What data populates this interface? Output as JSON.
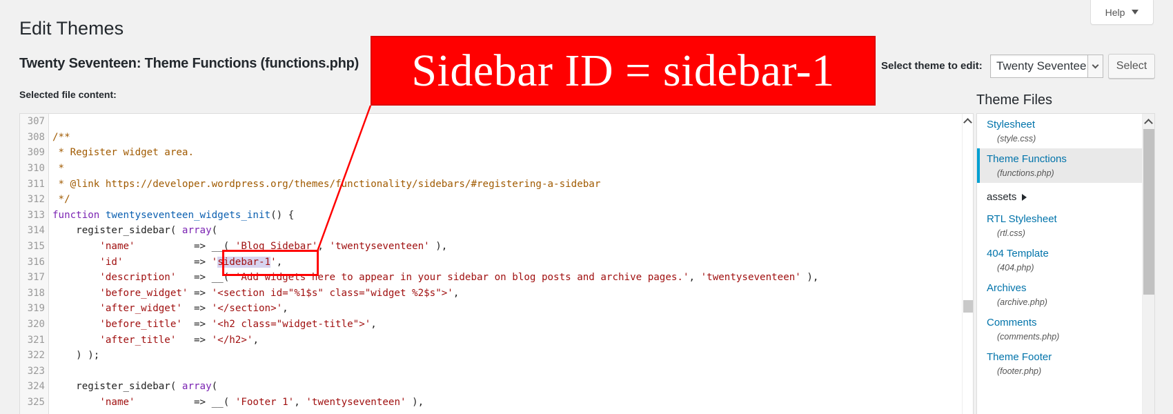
{
  "help": {
    "label": "Help"
  },
  "page_title": "Edit Themes",
  "file_heading": "Twenty Seventeen: Theme Functions (functions.php)",
  "theme_selector": {
    "label": "Select theme to edit:",
    "value": "Twenty Seventee",
    "button": "Select"
  },
  "selected_label": "Selected file content:",
  "theme_files": {
    "title": "Theme Files",
    "items": [
      {
        "name": "Stylesheet",
        "file": "(style.css)"
      },
      {
        "name": "Theme Functions",
        "file": "(functions.php)",
        "active": true
      },
      {
        "folder": "assets"
      },
      {
        "name": "RTL Stylesheet",
        "file": "(rtl.css)"
      },
      {
        "name": "404 Template",
        "file": "(404.php)"
      },
      {
        "name": "Archives",
        "file": "(archive.php)"
      },
      {
        "name": "Comments",
        "file": "(comments.php)"
      },
      {
        "name": "Theme Footer",
        "file": "(footer.php)"
      }
    ]
  },
  "annotation": {
    "text": "Sidebar ID = sidebar-1"
  },
  "code": [
    {
      "n": "307",
      "segs": [
        [
          "",
          "def"
        ]
      ]
    },
    {
      "n": "308",
      "segs": [
        [
          "/**",
          "com"
        ]
      ]
    },
    {
      "n": "309",
      "segs": [
        [
          " * Register widget area.",
          "com"
        ]
      ]
    },
    {
      "n": "310",
      "segs": [
        [
          " *",
          "com"
        ]
      ]
    },
    {
      "n": "311",
      "segs": [
        [
          " * @link https://developer.wordpress.org/themes/functionality/sidebars/#registering-a-sidebar",
          "com"
        ]
      ]
    },
    {
      "n": "312",
      "segs": [
        [
          " */",
          "com"
        ]
      ]
    },
    {
      "n": "313",
      "segs": [
        [
          "function",
          "kw"
        ],
        [
          " ",
          "def"
        ],
        [
          "twentyseventeen_widgets_init",
          "fn"
        ],
        [
          "() {",
          "def"
        ]
      ]
    },
    {
      "n": "314",
      "segs": [
        [
          "    register_sidebar( ",
          "def"
        ],
        [
          "array",
          "kw"
        ],
        [
          "(",
          "def"
        ]
      ]
    },
    {
      "n": "315",
      "segs": [
        [
          "        ",
          "def"
        ],
        [
          "'name'",
          "str"
        ],
        [
          "          => __( ",
          "def"
        ],
        [
          "'Blog Sidebar'",
          "str"
        ],
        [
          ", ",
          "def"
        ],
        [
          "'twentyseventeen'",
          "str"
        ],
        [
          " ),",
          "def"
        ]
      ]
    },
    {
      "n": "316",
      "segs": [
        [
          "        ",
          "def"
        ],
        [
          "'id'",
          "str"
        ],
        [
          "            => ",
          "def"
        ],
        [
          "'",
          "str"
        ],
        [
          "sidebar-1",
          "strhl"
        ],
        [
          "'",
          "str"
        ],
        [
          ",",
          "def"
        ]
      ]
    },
    {
      "n": "317",
      "segs": [
        [
          "        ",
          "def"
        ],
        [
          "'description'",
          "str"
        ],
        [
          "   => __( ",
          "def"
        ],
        [
          "'Add widgets here to appear in your sidebar on blog posts and archive pages.'",
          "str"
        ],
        [
          ", ",
          "def"
        ],
        [
          "'twentyseventeen'",
          "str"
        ],
        [
          " ),",
          "def"
        ]
      ]
    },
    {
      "n": "318",
      "segs": [
        [
          "        ",
          "def"
        ],
        [
          "'before_widget'",
          "str"
        ],
        [
          " => ",
          "def"
        ],
        [
          "'<section id=\"%1$s\" class=\"widget %2$s\">'",
          "str"
        ],
        [
          ",",
          "def"
        ]
      ]
    },
    {
      "n": "319",
      "segs": [
        [
          "        ",
          "def"
        ],
        [
          "'after_widget'",
          "str"
        ],
        [
          "  => ",
          "def"
        ],
        [
          "'</section>'",
          "str"
        ],
        [
          ",",
          "def"
        ]
      ]
    },
    {
      "n": "320",
      "segs": [
        [
          "        ",
          "def"
        ],
        [
          "'before_title'",
          "str"
        ],
        [
          "  => ",
          "def"
        ],
        [
          "'<h2 class=\"widget-title\">'",
          "str"
        ],
        [
          ",",
          "def"
        ]
      ]
    },
    {
      "n": "321",
      "segs": [
        [
          "        ",
          "def"
        ],
        [
          "'after_title'",
          "str"
        ],
        [
          "   => ",
          "def"
        ],
        [
          "'</h2>'",
          "str"
        ],
        [
          ",",
          "def"
        ]
      ]
    },
    {
      "n": "322",
      "segs": [
        [
          "    ) );",
          "def"
        ]
      ]
    },
    {
      "n": "323",
      "segs": [
        [
          "",
          "def"
        ]
      ]
    },
    {
      "n": "324",
      "segs": [
        [
          "    register_sidebar( ",
          "def"
        ],
        [
          "array",
          "kw"
        ],
        [
          "(",
          "def"
        ]
      ]
    },
    {
      "n": "325",
      "segs": [
        [
          "        ",
          "def"
        ],
        [
          "'name'",
          "str"
        ],
        [
          "          => __( ",
          "def"
        ],
        [
          "'Footer 1'",
          "str"
        ],
        [
          ", ",
          "def"
        ],
        [
          "'twentyseventeen'",
          "str"
        ],
        [
          " ),",
          "def"
        ]
      ]
    }
  ]
}
